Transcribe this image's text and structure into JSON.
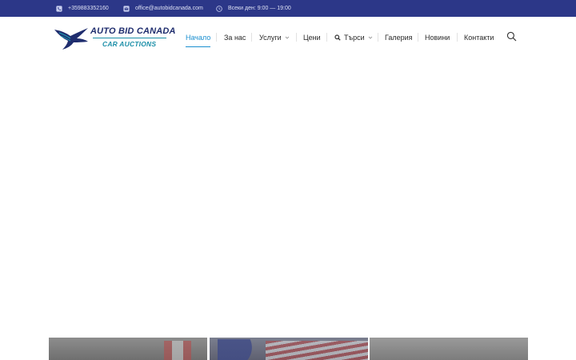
{
  "topbar": {
    "phone": "+359883352160",
    "email": "office@autobidcanada.com",
    "hours": "Всеки ден: 9:00 — 19:00"
  },
  "logo": {
    "line1": "AUTO BID CANADA",
    "line2": "CAR AUCTIONS"
  },
  "nav": {
    "items": [
      {
        "label": "Начало",
        "active": true
      },
      {
        "label": "За нас"
      },
      {
        "label": "Услуги",
        "dropdown": true
      },
      {
        "label": "Цени"
      },
      {
        "label": "Търси",
        "dropdown": true,
        "icon": "search-icon"
      },
      {
        "label": "Галерия"
      },
      {
        "label": "Новини"
      },
      {
        "label": "Контакти"
      }
    ]
  },
  "colors": {
    "topbar": "#2c3788",
    "accent": "#1a8fd0",
    "logo_dark": "#1f2d6e",
    "logo_teal": "#1c8fa8"
  }
}
